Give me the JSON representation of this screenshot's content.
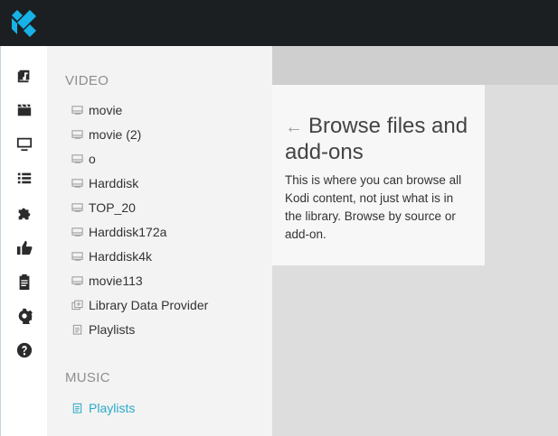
{
  "sidebar": {
    "video_title": "VIDEO",
    "video_items": [
      "movie",
      "movie (2)",
      "o",
      "Harddisk",
      "TOP_20",
      "Harddisk172a",
      "Harddisk4k",
      "movie113",
      "Library Data Provider",
      "Playlists"
    ],
    "music_title": "MUSIC",
    "music_items": [
      "Playlists"
    ]
  },
  "nav_icons": [
    "library-icon",
    "movies-icon",
    "tv-icon",
    "list-icon",
    "addons-icon",
    "thumbs-up-icon",
    "clipboard-icon",
    "settings-icon",
    "help-icon"
  ],
  "card": {
    "back_arrow": "←",
    "title": "Browse files and add-ons",
    "body": "This is where you can browse all Kodi content, not just what is in the library. Browse by source or add-on."
  },
  "colors": {
    "topbar": "#1b1f21",
    "accent": "#2aa9c9",
    "logo": "#17b2e7"
  }
}
